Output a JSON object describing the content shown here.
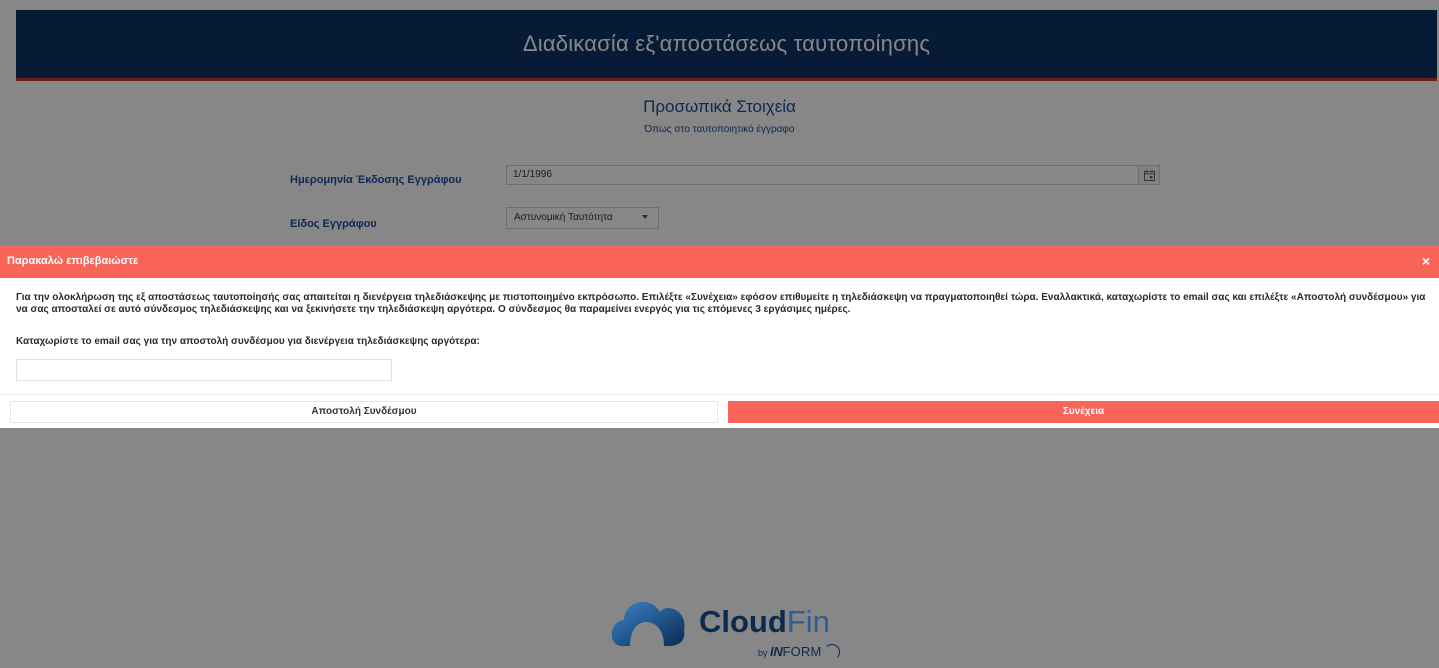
{
  "app": {
    "banner_title": "Διαδικασία εξ'αποστάσεως ταυτοποίησης"
  },
  "form": {
    "section_title": "Προσωπικά Στοιχεία",
    "section_subtitle": "Όπως στο ταυτοποιητικό έγγραφο",
    "issue_date_label": "Ημερομηνία Έκδοσης Εγγράφου",
    "issue_date_value": "1/1/1996",
    "doc_type_label": "Είδος Εγγράφου",
    "doc_type_value": "Αστυνομική Ταυτότητα"
  },
  "dialog": {
    "title": "Παρακαλώ επιβεβαιώστε",
    "close_glyph": "×",
    "message": "Για την ολοκλήρωση της εξ αποστάσεως ταυτοποίησής σας απαιτείται η διενέργεια τηλεδιάσκεψης με πιστοποιημένο εκπρόσωπο. Επιλέξτε «Συνέχεια» εφόσον επιθυμείτε η τηλεδιάσκεψη να πραγματοποιηθεί τώρα. Εναλλακτικά, καταχωρίστε το email σας και επιλέξτε «Αποστολή συνδέσμου» για να σας αποσταλεί σε αυτό σύνδεσμος τηλεδιάσκεψης και να ξεκινήσετε την τηλεδιάσκεψη αργότερα. Ο σύνδεσμος θα παραμείνει ενεργός για τις επόμενες 3 εργάσιμες ημέρες.",
    "email_prompt": "Καταχωρίστε το email σας για την αποστολή συνδέσμου για διενέργεια τηλεδιάσκεψης αργότερα:",
    "email_value": "",
    "send_link_label": "Αποστολή Συνδέσμου",
    "continue_label": "Συνέχεια"
  },
  "logo": {
    "name_bold": "Cloud",
    "name_light": "Fin",
    "by": "by",
    "brand_bold": "IN",
    "brand_light": "FORM"
  },
  "colors": {
    "banner": "#0f3369",
    "accent": "#f86458",
    "label": "#1b4ea0"
  }
}
